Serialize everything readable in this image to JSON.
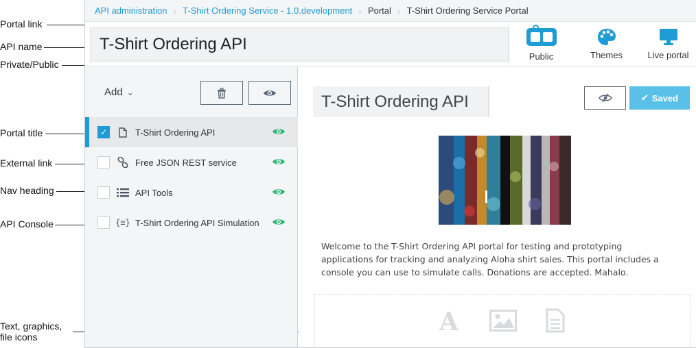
{
  "callouts": [
    {
      "label": "Portal link"
    },
    {
      "label": "API name"
    },
    {
      "label": "Private/Public"
    },
    {
      "label": "Portal title"
    },
    {
      "label": "External link"
    },
    {
      "label": "Nav heading"
    },
    {
      "label": "API Console"
    },
    {
      "label": "Text, graphics,"
    },
    {
      "label": "file icons"
    }
  ],
  "breadcrumb": [
    {
      "label": "API administration"
    },
    {
      "label": "T-Shirt Ordering Service - 1.0.development"
    },
    {
      "label": "Portal"
    },
    {
      "label": "T-Shirt Ordering Service Portal"
    }
  ],
  "header": {
    "api_name": "T-Shirt Ordering API",
    "buttons": [
      {
        "label": "Public",
        "icon": "lock-toggle-icon"
      },
      {
        "label": "Themes",
        "icon": "palette-icon"
      },
      {
        "label": "Live portal",
        "icon": "monitor-icon"
      }
    ]
  },
  "sidebar": {
    "add_label": "Add",
    "items": [
      {
        "label": "T-Shirt Ordering API",
        "icon": "page-icon",
        "checked": true
      },
      {
        "label": "Free JSON REST service",
        "icon": "link-icon",
        "checked": false
      },
      {
        "label": "API Tools",
        "icon": "list-icon",
        "checked": false
      },
      {
        "label": "T-Shirt Ordering API Simulation",
        "icon": "console-icon",
        "checked": false
      }
    ]
  },
  "content": {
    "portal_title": "T-Shirt Ordering API",
    "saved_label": "Saved",
    "welcome_text": "Welcome to the T-Shirt Ordering API portal for testing and prototyping applications for tracking and analyzing Aloha shirt sales. This portal includes a console you can use to simulate calls. Donations are accepted. Mahalo."
  },
  "colors": {
    "accent": "#1f9bd6",
    "eye_green": "#2bb673",
    "saved_bg": "#5bc0e8"
  }
}
